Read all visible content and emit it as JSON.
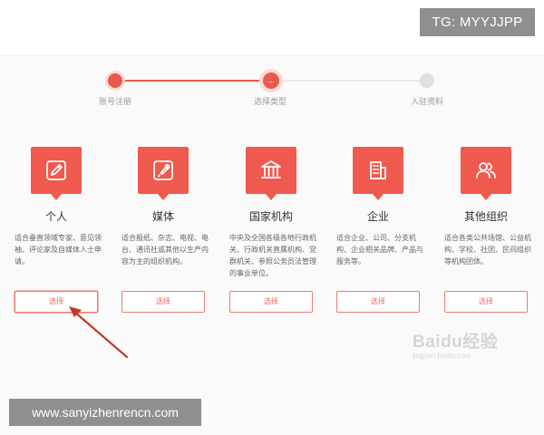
{
  "overlay": {
    "tg_badge": "TG: MYYJJPP",
    "url_badge": "www.sanyizhenrencn.com"
  },
  "stepper": {
    "steps": [
      {
        "label": "账号注册",
        "state": "done"
      },
      {
        "label": "选择类型",
        "state": "current",
        "glyph": "..."
      },
      {
        "label": "入驻资料",
        "state": "todo"
      }
    ]
  },
  "cards": [
    {
      "title": "个人",
      "icon": "pencil-icon",
      "description": "适合垂直领域专家、意见领袖、评论家及自媒体人士申请。",
      "button": "选择",
      "highlighted": true
    },
    {
      "title": "媒体",
      "icon": "microphone-icon",
      "description": "适合报纸、杂志、电视、电台、通讯社或其他以生产内容为主的组织机构。",
      "button": "选择"
    },
    {
      "title": "国家机构",
      "icon": "government-building-icon",
      "description": "中央及全国各级各地行政机关、行政机关直属机构、党群机关、参照公务员法管理的事业单位。",
      "button": "选择"
    },
    {
      "title": "企业",
      "icon": "office-building-icon",
      "description": "适合企业、公司、分支机构、企业相关品牌、产品与服务等。",
      "button": "选择"
    },
    {
      "title": "其他组织",
      "icon": "group-icon",
      "description": "适合各类公共场馆、公益机构、学校、社团、民间组织等机构团体。",
      "button": "选择"
    }
  ],
  "watermark": {
    "text": "Baidu经验",
    "sub": "jingyan.baidu.com"
  },
  "colors": {
    "accent": "#f0594e",
    "button_border": "#ef7b70",
    "overlay_gray": "#8f8f8f"
  }
}
